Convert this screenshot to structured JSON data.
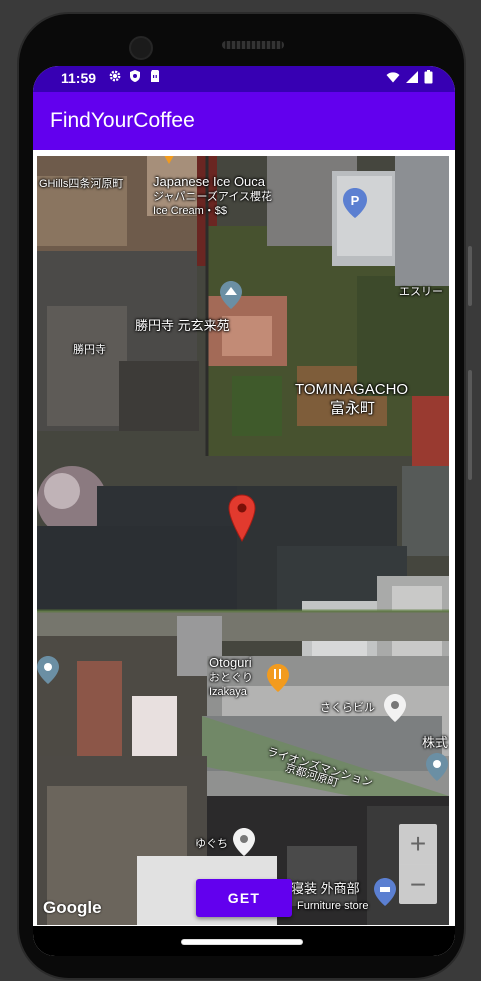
{
  "status_bar": {
    "time": "11:59",
    "left_icons": [
      "gear-icon",
      "shield-icon",
      "sim-card-icon"
    ],
    "right_icons": [
      "wifi-icon",
      "signal-icon",
      "battery-icon"
    ]
  },
  "app_bar": {
    "title": "FindYourCoffee"
  },
  "map": {
    "labels": {
      "ghills": "GHills四条河原町",
      "ice_cafe_en": "Japanese Ice Ouca",
      "ice_cafe_jp": "ジャパニーズアイス櫻花",
      "ice_cafe_sub": "Ice Cream・$$",
      "temple_garden": "勝円寺 元玄来苑",
      "temple": "勝円寺",
      "district_en": "TOMINAGACHO",
      "district_jp": "富永町",
      "essuri": "エスリー",
      "otoguri_en": "Otoguri",
      "otoguri_jp": "おとぐり",
      "otoguri_sub": "Izakaya",
      "sakura_building": "さくらビル",
      "kabushiki": "株式",
      "lions_mansion": "ライオンズマンション",
      "kyoto_kawaramachi": "京都河原町",
      "yuguchi": "ゆぐち",
      "furniture_jp": "寝装 外商部",
      "furniture_en": "Furniture store",
      "google": "Google"
    },
    "selected_marker": "red-location-pin-icon",
    "zoom_in_label": "+",
    "zoom_out_label": "−"
  },
  "actions": {
    "get_label": "GET"
  },
  "colors": {
    "status_bar": "#3700b3",
    "app_bar": "#6200ee",
    "button": "#6200ee",
    "marker": "#d93025"
  }
}
